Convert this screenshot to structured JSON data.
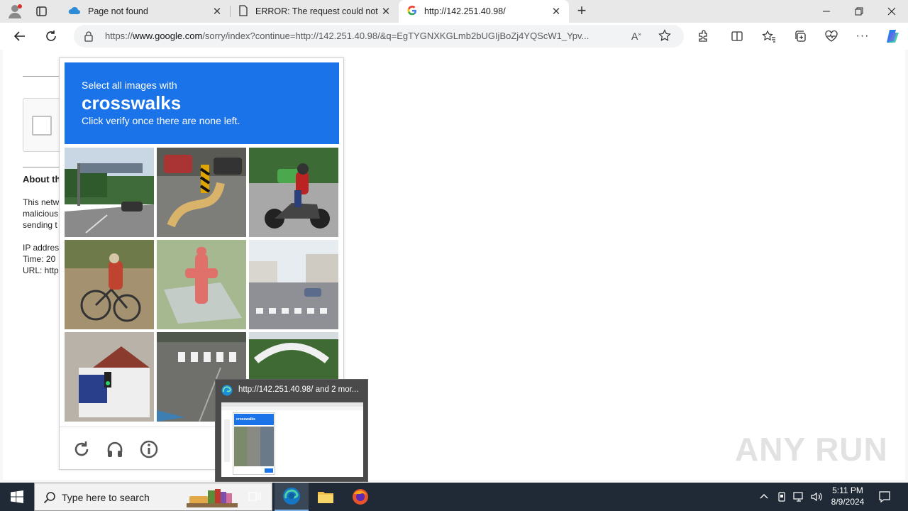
{
  "browser": {
    "tabs": [
      {
        "title": "Page not found",
        "icon": "cloud-icon",
        "active": false
      },
      {
        "title": "ERROR: The request could not be",
        "icon": "document-icon",
        "active": false
      },
      {
        "title": "http://142.251.40.98/",
        "icon": "google-icon",
        "active": true
      }
    ],
    "new_tab_symbol": "+",
    "address": {
      "prefix": "https://",
      "domain": "www.google.com",
      "path": "/sorry/index?continue=http://142.251.40.98/&q=EgTYGNXKGLmb2bUGIjBoZj4YQScW1_Ypv..."
    }
  },
  "page": {
    "heading": "About th",
    "lines": [
      "This netw",
      "malicious",
      "sending t",
      "",
      "IP addres",
      "Time: 20",
      "URL: http"
    ]
  },
  "captcha": {
    "instruction_line1": "Select all images with",
    "target": "crosswalks",
    "instruction_line3": "Click verify once there are none left.",
    "tiles": [
      {
        "name": "tile-highway-sign"
      },
      {
        "name": "tile-road-barrier"
      },
      {
        "name": "tile-motorcycle"
      },
      {
        "name": "tile-bicycle"
      },
      {
        "name": "tile-fire-hydrant"
      },
      {
        "name": "tile-street-crosswalk"
      },
      {
        "name": "tile-building-traffic-light"
      },
      {
        "name": "tile-road-crosswalk"
      },
      {
        "name": "tile-tree-arch"
      }
    ],
    "footer_icons": [
      "reload-icon",
      "audio-icon",
      "info-icon"
    ]
  },
  "thumbnail_popup": {
    "title": "http://142.251.40.98/ and 2 mor...",
    "preview_heading": "crosswalks"
  },
  "taskbar": {
    "search_placeholder": "Type here to search",
    "time": "5:11 PM",
    "date": "8/9/2024"
  },
  "watermark": "ANY RUN",
  "colors": {
    "captcha_header": "#1a73e8",
    "taskbar": "#1f2a36"
  }
}
